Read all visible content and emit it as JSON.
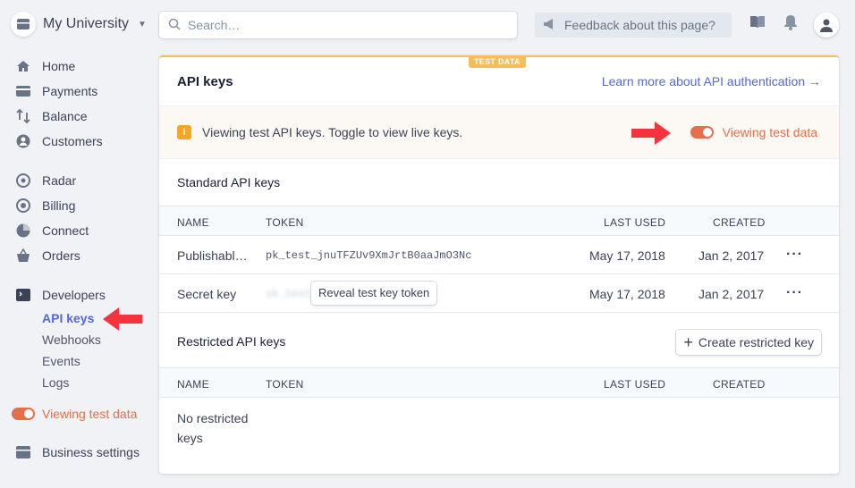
{
  "colors": {
    "accent": "#5469d4",
    "test_mode": "#e56f4a",
    "test_badge": "#f5be58",
    "arrow": "#f5333f"
  },
  "header": {
    "account_name": "My University",
    "search_placeholder": "Search…",
    "feedback_label": "Feedback about this page?"
  },
  "sidebar": {
    "items": [
      {
        "label": "Home",
        "icon": "home-icon"
      },
      {
        "label": "Payments",
        "icon": "payments-icon"
      },
      {
        "label": "Balance",
        "icon": "balance-icon"
      },
      {
        "label": "Customers",
        "icon": "customers-icon"
      },
      {
        "label": "Radar",
        "icon": "radar-icon"
      },
      {
        "label": "Billing",
        "icon": "billing-icon"
      },
      {
        "label": "Connect",
        "icon": "connect-icon"
      },
      {
        "label": "Orders",
        "icon": "orders-icon"
      },
      {
        "label": "Developers",
        "icon": "terminal-icon"
      }
    ],
    "developer_subitems": [
      "API keys",
      "Webhooks",
      "Events",
      "Logs"
    ],
    "test_toggle_label": "Viewing test data",
    "business_settings": "Business settings"
  },
  "main": {
    "test_badge": "TEST DATA",
    "title": "API keys",
    "learn_link": "Learn more about API authentication →",
    "banner_text": "Viewing test API keys. Toggle to view live keys.",
    "banner_toggle_label": "Viewing test data",
    "standard": {
      "title": "Standard API keys",
      "columns": [
        "NAME",
        "TOKEN",
        "LAST USED",
        "CREATED"
      ],
      "rows": [
        {
          "name": "Publishabl…",
          "token": "pk_test_jnuTFZUv9XmJrtB0aaJmO3Nc",
          "last_used": "May 17, 2018",
          "created": "Jan 2, 2017"
        },
        {
          "name": "Secret key",
          "token": "sk_test_••••••••••••••••••",
          "reveal": "Reveal test key token",
          "last_used": "May 17, 2018",
          "created": "Jan 2, 2017"
        }
      ]
    },
    "restricted": {
      "title": "Restricted API keys",
      "create_label": "Create restricted key",
      "columns": [
        "NAME",
        "TOKEN",
        "LAST USED",
        "CREATED"
      ],
      "empty": "No restricted keys"
    }
  }
}
